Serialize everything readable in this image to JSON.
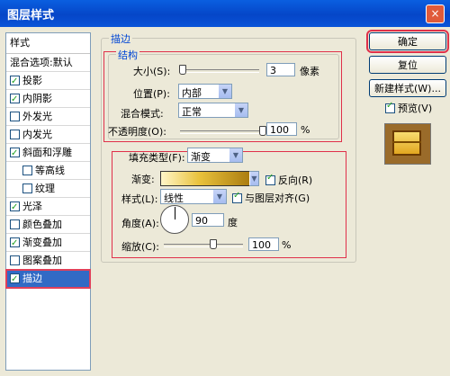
{
  "window": {
    "title": "图层样式",
    "close": "×"
  },
  "sidebar": {
    "header": "样式",
    "items": [
      {
        "label": "混合选项:默认",
        "checkbox": false,
        "checked": false,
        "sub": false,
        "selected": false
      },
      {
        "label": "投影",
        "checkbox": true,
        "checked": true,
        "sub": false,
        "selected": false
      },
      {
        "label": "内阴影",
        "checkbox": true,
        "checked": true,
        "sub": false,
        "selected": false
      },
      {
        "label": "外发光",
        "checkbox": true,
        "checked": false,
        "sub": false,
        "selected": false
      },
      {
        "label": "内发光",
        "checkbox": true,
        "checked": false,
        "sub": false,
        "selected": false
      },
      {
        "label": "斜面和浮雕",
        "checkbox": true,
        "checked": true,
        "sub": false,
        "selected": false
      },
      {
        "label": "等高线",
        "checkbox": true,
        "checked": false,
        "sub": true,
        "selected": false
      },
      {
        "label": "纹理",
        "checkbox": true,
        "checked": false,
        "sub": true,
        "selected": false
      },
      {
        "label": "光泽",
        "checkbox": true,
        "checked": true,
        "sub": false,
        "selected": false
      },
      {
        "label": "颜色叠加",
        "checkbox": true,
        "checked": false,
        "sub": false,
        "selected": false
      },
      {
        "label": "渐变叠加",
        "checkbox": true,
        "checked": true,
        "sub": false,
        "selected": false
      },
      {
        "label": "图案叠加",
        "checkbox": true,
        "checked": false,
        "sub": false,
        "selected": false
      },
      {
        "label": "描边",
        "checkbox": true,
        "checked": true,
        "sub": false,
        "selected": true
      }
    ]
  },
  "stroke": {
    "group_title": "描边",
    "structure": {
      "title": "结构",
      "size_label": "大小(S):",
      "size_value": "3",
      "size_unit": "像素",
      "position_label": "位置(P):",
      "position_value": "内部",
      "blend_label": "混合模式:",
      "blend_value": "正常",
      "opacity_label": "不透明度(O):",
      "opacity_value": "100",
      "opacity_unit": "%"
    },
    "fill": {
      "fill_type_label": "填充类型(F):",
      "fill_type_value": "渐变",
      "gradient_label": "渐变:",
      "reverse_label": "反向(R)",
      "style_label": "样式(L):",
      "style_value": "线性",
      "align_label": "与图层对齐(G)",
      "angle_label": "角度(A):",
      "angle_value": "90",
      "angle_unit": "度",
      "scale_label": "缩放(C):",
      "scale_value": "100",
      "scale_unit": "%"
    }
  },
  "buttons": {
    "ok": "确定",
    "reset": "复位",
    "new_style": "新建样式(W)...",
    "preview": "预览(V)"
  }
}
